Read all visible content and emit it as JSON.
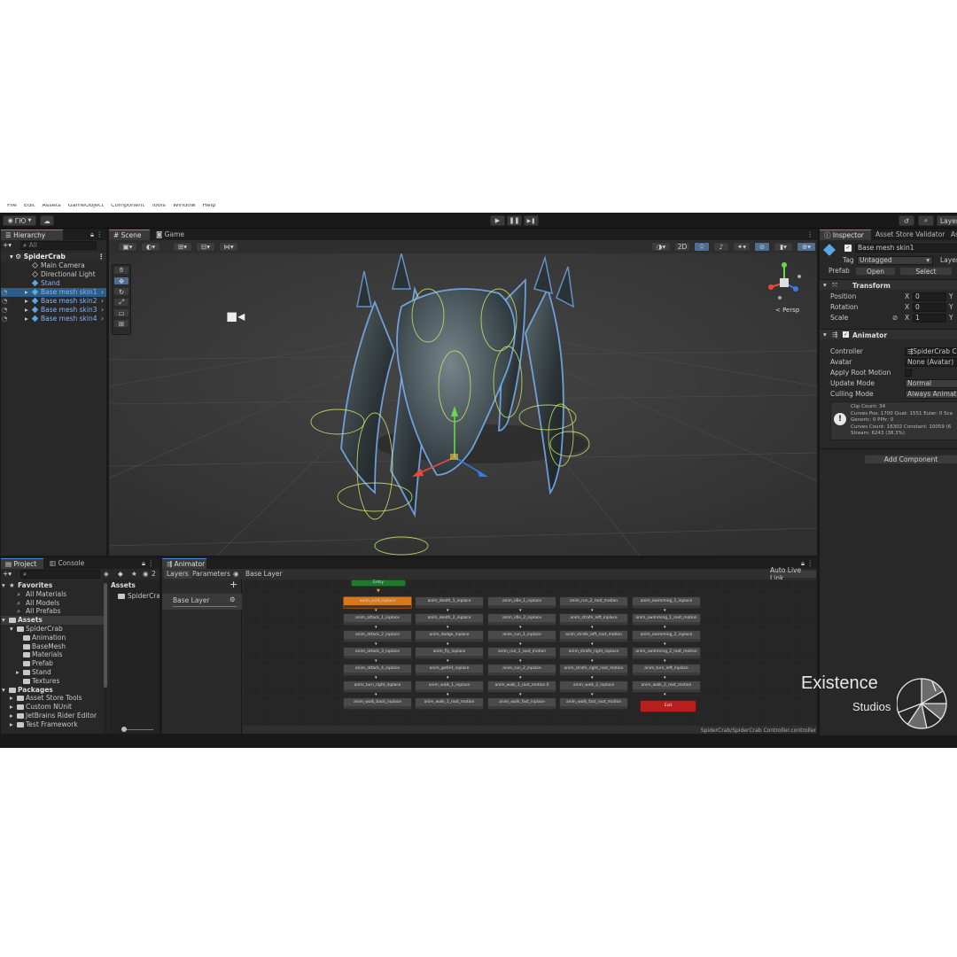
{
  "menubar": [
    "File",
    "Edit",
    "Assets",
    "GameObject",
    "Component",
    "Tools",
    "Window",
    "Help"
  ],
  "toolbar": {
    "account": "ГЮ",
    "layers": "Layer"
  },
  "hierarchy": {
    "tab": "Hierarchy",
    "search_placeholder": "All",
    "root": "SpiderCrab",
    "items": [
      {
        "label": "Main Camera",
        "selected": false
      },
      {
        "label": "Directional Light",
        "selected": false
      },
      {
        "label": "Stand",
        "selected": false
      },
      {
        "label": "Base mesh skin1",
        "selected": true
      },
      {
        "label": "Base mesh skin2",
        "selected": false
      },
      {
        "label": "Base mesh skin3",
        "selected": false
      },
      {
        "label": "Base mesh skin4",
        "selected": false
      }
    ]
  },
  "scene": {
    "tabs": [
      "Scene",
      "Game"
    ],
    "toggle_2d": "2D",
    "persp_label": "< Persp"
  },
  "inspector": {
    "tabs": [
      "Inspector",
      "Asset Store Validator",
      "As"
    ],
    "object_name": "Base mesh skin1",
    "tag_label": "Tag",
    "tag_value": "Untagged",
    "layer_label": "Layer",
    "prefab_label": "Prefab",
    "open_label": "Open",
    "select_label": "Select",
    "transform_title": "Transform",
    "position_label": "Position",
    "rotation_label": "Rotation",
    "scale_label": "Scale",
    "x_label": "X",
    "y_label": "Y",
    "position_x": "0",
    "rotation_x": "0",
    "scale_x": "1",
    "animator_title": "Animator",
    "controller_label": "Controller",
    "controller_value": "SpiderCrab Co",
    "avatar_label": "Avatar",
    "avatar_value": "None (Avatar)",
    "root_motion_label": "Apply Root Motion",
    "update_mode_label": "Update Mode",
    "update_mode_value": "Normal",
    "culling_label": "Culling Mode",
    "culling_value": "Always Animate",
    "info_lines": [
      "Clip Count: 34",
      "Curves Pos: 1700 Quat: 1551 Euler: 0 Sca",
      "Generic: 0 PPtr: 0",
      "Curves Count: 16302 Constant: 10059 (6",
      "Stream: 6243 (38.3%)"
    ],
    "add_component": "Add Component"
  },
  "project": {
    "tabs": [
      "Project",
      "Console"
    ],
    "count": "2",
    "favorites_label": "Favorites",
    "favorites": [
      "All Materials",
      "All Models",
      "All Prefabs"
    ],
    "assets_label": "Assets",
    "tree": [
      "SpiderCrab",
      "Animation",
      "BaseMesh",
      "Materials",
      "Prefab",
      "Stand",
      "Textures"
    ],
    "packages_label": "Packages",
    "packages": [
      "Asset Store Tools",
      "Custom NUnit",
      "JetBrains Rider Editor",
      "Test Framework"
    ],
    "breadcrumb": "Assets",
    "folder_item": "SpiderCrab"
  },
  "animator": {
    "tab": "Animator",
    "layers_tab": "Layers",
    "parameters_tab": "Parameters",
    "breadcrumb": "Base Layer",
    "auto_live_link": "Auto Live Link",
    "layer_name": "Base Layer",
    "entry_label": "Entry",
    "exit_label": "Exit",
    "footer_path": "SpiderCrab/SpiderCrab Controller.controller",
    "columns": [
      [
        "anim_acid_inplace",
        "anim_attack_1_inplace",
        "anim_attack_2_inplace",
        "anim_attack_3_inplace",
        "anim_attack_4_inplace",
        "anim_turn_right_inplace",
        "anim_walk_back_inplace"
      ],
      [
        "anim_death_1_inplace",
        "anim_death_2_inplace",
        "anim_dodge_inplace",
        "anim_fly_inplace",
        "anim_getHit_inplace",
        "anim_walk_1_inplace",
        "anim_walk_1_root_motion"
      ],
      [
        "anim_idle_1_inplace",
        "anim_idle_2_inplace",
        "anim_run_1_inplace",
        "anim_run_1_root_motion",
        "anim_run_2_inplace",
        "anim_walk_1_root_motion 0",
        "anim_walk_fast_inplace"
      ],
      [
        "anim_run_2_root_motion",
        "anim_strafe_left_inplace",
        "anim_strafe_left_root_motion",
        "anim_strafe_right_inplace",
        "anim_strafe_right_root_motion",
        "anim_walk_2_inplace",
        "anim_walk_fast_root_motion"
      ],
      [
        "anim_swimming_1_inplace",
        "anim_swimming_1_root_motion",
        "anim_swimming_2_inplace",
        "anim_swimming_2_root_motion",
        "anim_turn_left_inplace",
        "anim_walk_2_root_motion"
      ]
    ]
  },
  "watermark": {
    "title": "Existence",
    "subtitle": "Studios"
  }
}
